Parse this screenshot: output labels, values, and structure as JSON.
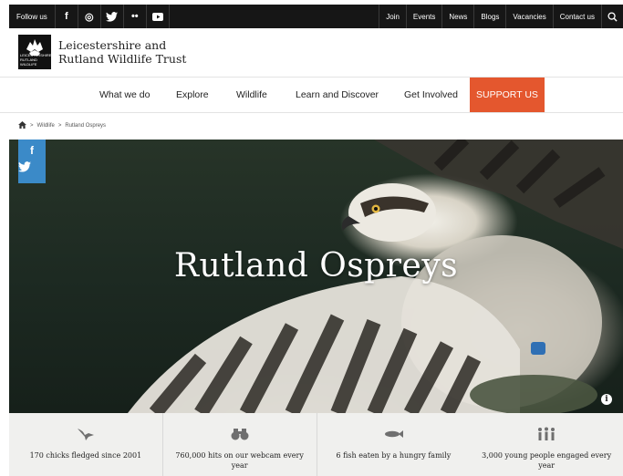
{
  "topbar": {
    "follow_label": "Follow us",
    "social": [
      {
        "name": "facebook-icon",
        "glyph": "f"
      },
      {
        "name": "instagram-icon",
        "glyph": "◎"
      },
      {
        "name": "twitter-icon",
        "glyph": "🐦"
      },
      {
        "name": "flickr-icon",
        "glyph": "••"
      },
      {
        "name": "youtube-icon",
        "glyph": "▶"
      }
    ],
    "links": [
      "Join",
      "Events",
      "News",
      "Blogs",
      "Vacancies",
      "Contact us"
    ],
    "search_icon": "search-icon"
  },
  "logo": {
    "line1": "Leicestershire and",
    "line2": "Rutland Wildlife Trust",
    "badge": "LEICESTERSHIRE RUTLAND WILDLIFE"
  },
  "nav": {
    "items": [
      "What we do",
      "Explore",
      "Wildlife",
      "Learn and Discover",
      "Get Involved"
    ],
    "support": "SUPPORT US",
    "support_color": "#e4572e"
  },
  "breadcrumb": {
    "home_icon": "home-icon",
    "items": [
      "Wildlife",
      "Rutland Ospreys"
    ],
    "separator": ">"
  },
  "hero": {
    "title": "Rutland Ospreys",
    "share": [
      "f",
      "🐦"
    ],
    "share_color": "#3b8ac8",
    "info_icon": "info-icon",
    "info_glyph": "i"
  },
  "stats": [
    {
      "icon": "bird-icon",
      "text": "170 chicks fledged since 2001"
    },
    {
      "icon": "binoculars-icon",
      "text": "760,000 hits on our webcam every year"
    },
    {
      "icon": "fish-icon",
      "text": "6 fish eaten by a hungry family"
    },
    {
      "icon": "people-icon",
      "text": "3,000 young people engaged every year"
    }
  ]
}
